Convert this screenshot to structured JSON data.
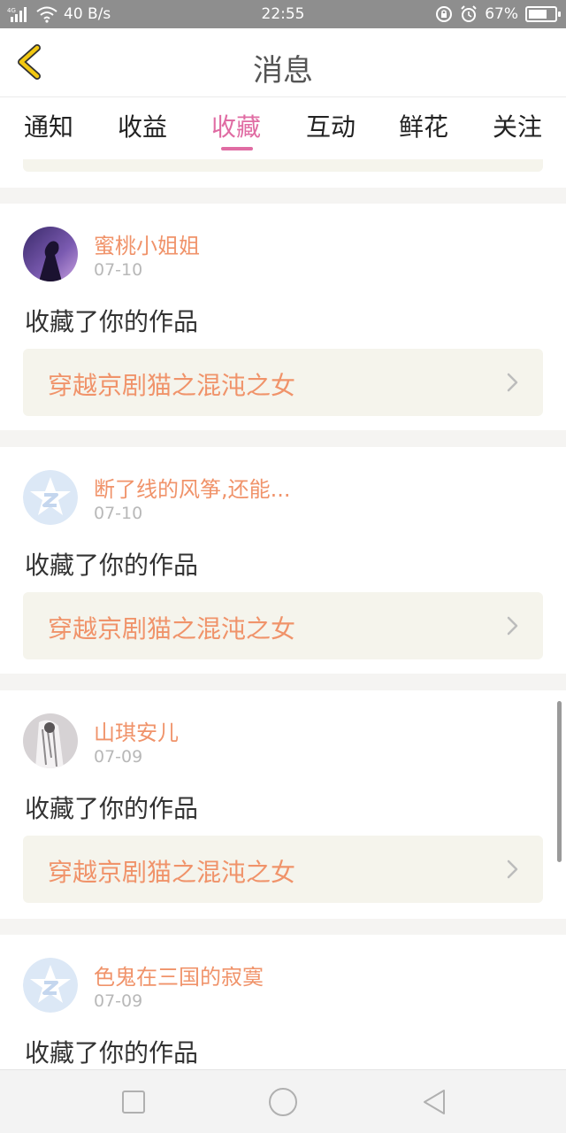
{
  "status_bar": {
    "network": "4G",
    "speed": "40 B/s",
    "time": "22:55",
    "battery": "67%"
  },
  "header": {
    "title": "消息",
    "back_icon": "chevron-left-icon",
    "accent": "#f2c811"
  },
  "tabs": [
    {
      "label": "通知",
      "active": false
    },
    {
      "label": "收益",
      "active": false
    },
    {
      "label": "收藏",
      "active": true
    },
    {
      "label": "互动",
      "active": false
    },
    {
      "label": "鲜花",
      "active": false
    },
    {
      "label": "关注",
      "active": false
    }
  ],
  "colors": {
    "active_tab": "#e06ca3",
    "username": "#f0936a",
    "work_bg": "#f5f4ec"
  },
  "items": [
    {
      "username": "蜜桃小姐姐",
      "date": "07-10",
      "action": "收藏了你的作品",
      "work_title": "穿越京剧猫之混沌之女",
      "avatar": "photo-avatar-purple"
    },
    {
      "username": "断了线的风筝,还能...",
      "date": "07-10",
      "action": "收藏了你的作品",
      "work_title": "穿越京剧猫之混沌之女",
      "avatar": "default-star-avatar"
    },
    {
      "username": "山琪安儿",
      "date": "07-09",
      "action": "收藏了你的作品",
      "work_title": "穿越京剧猫之混沌之女",
      "avatar": "photo-avatar-gray"
    },
    {
      "username": "色鬼在三国的寂寞",
      "date": "07-09",
      "action": "收藏了你的作品",
      "work_title": "",
      "avatar": "default-star-avatar"
    }
  ]
}
